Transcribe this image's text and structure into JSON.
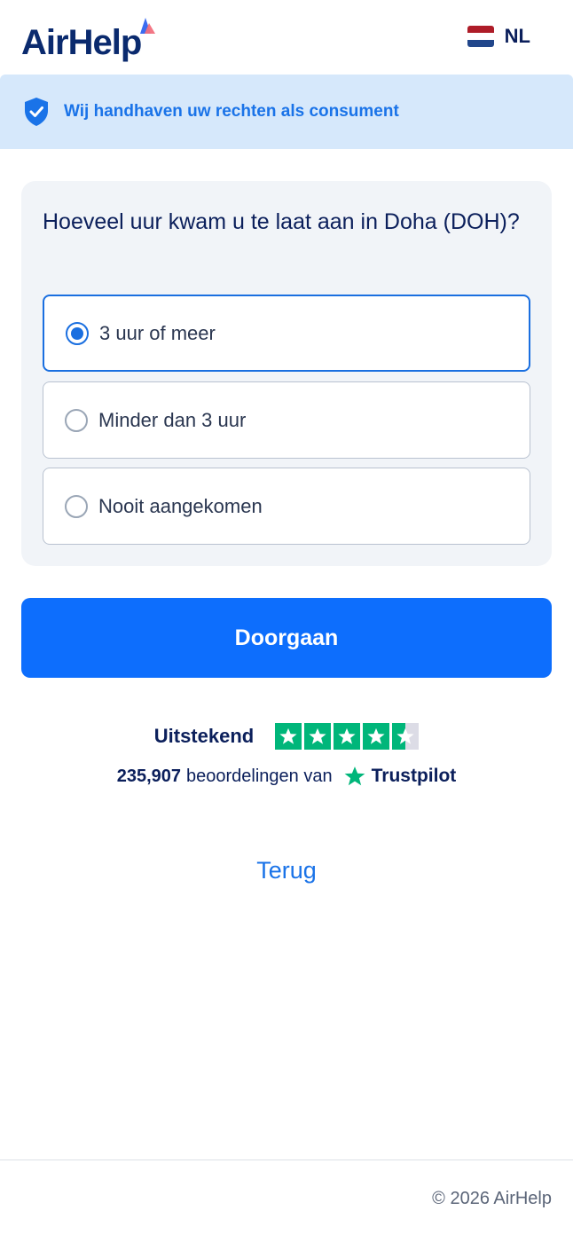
{
  "header": {
    "logo_text": "AirHelp",
    "language": "NL",
    "flag_colors": [
      "#ae1c28",
      "#ffffff",
      "#21468b"
    ]
  },
  "banner": {
    "icon": "shield-check-icon",
    "text": "Wij handhaven uw rechten als consument"
  },
  "question": {
    "title": "Hoeveel uur kwam u te laat aan in Doha (DOH)?",
    "options": [
      {
        "label": "3 uur of meer",
        "selected": true
      },
      {
        "label": "Minder dan 3 uur",
        "selected": false
      },
      {
        "label": "Nooit aangekomen",
        "selected": false
      }
    ]
  },
  "actions": {
    "continue_label": "Doorgaan",
    "back_label": "Terug"
  },
  "trustpilot": {
    "rating_text": "Uitstekend",
    "stars": 4.5,
    "review_count": "235,907",
    "reviews_text": "beoordelingen van",
    "brand": "Trustpilot",
    "brand_color": "#00b67a"
  },
  "footer": {
    "copyright": "© 2026 AirHelp"
  },
  "colors": {
    "primary": "#0d6efd",
    "navy": "#0b1f5b",
    "banner_bg": "#d6e8fb"
  }
}
